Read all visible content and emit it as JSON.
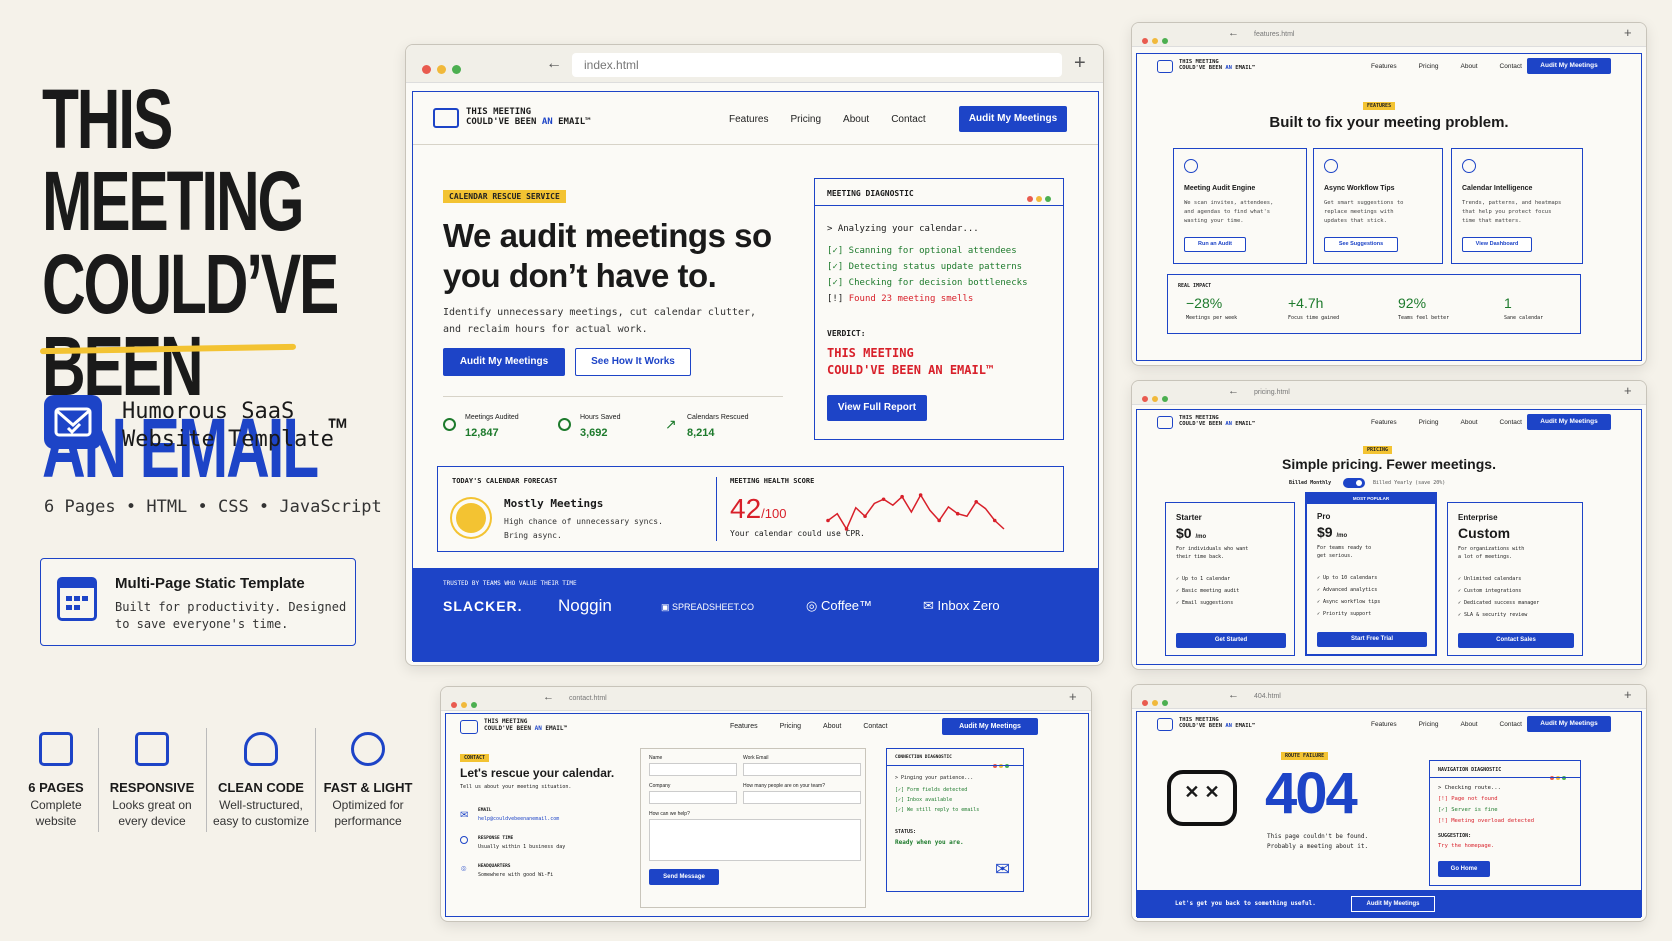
{
  "hero": {
    "line1": "THIS MEETING",
    "line2": "COULD’VE BEEN",
    "line3": "AN EMAIL",
    "tm": "™"
  },
  "subtitle": {
    "line1": "Humorous SaaS",
    "line2": "Website Template"
  },
  "tech": "6 Pages • HTML • CSS • JavaScript",
  "multipage": {
    "title": "Multi-Page Static Template",
    "desc1": "Built for productivity. Designed",
    "desc2": "to save everyone's time."
  },
  "features": [
    {
      "title": "6 PAGES",
      "d1": "Complete",
      "d2": "website",
      "icon": "pages-icon"
    },
    {
      "title": "RESPONSIVE",
      "d1": "Looks great on",
      "d2": "every device",
      "icon": "monitor-icon"
    },
    {
      "title": "CLEAN CODE",
      "d1": "Well-structured,",
      "d2": "easy to customize",
      "icon": "code-icon"
    },
    {
      "title": "FAST & LIGHT",
      "d1": "Optimized for",
      "d2": "performance",
      "icon": "speedometer-icon"
    }
  ],
  "nav": {
    "features": "Features",
    "pricing": "Pricing",
    "about": "About",
    "contact": "Contact",
    "cta": "Audit My Meetings"
  },
  "logo": {
    "l1": "THIS MEETING",
    "l2a": "COULD'VE BEEN ",
    "l2b": "AN",
    "l2c": " EMAIL™"
  },
  "main": {
    "url": "index.html",
    "tag": "CALENDAR RESCUE SERVICE",
    "h1a": "We audit meetings so",
    "h1b": "you don’t have to.",
    "p1": "Identify unnecessary meetings, cut calendar clutter,",
    "p2": "and reclaim hours for actual work.",
    "btn1": "Audit My Meetings",
    "btn2": "See How It Works",
    "stats": [
      {
        "label": "Meetings Audited",
        "value": "12,847"
      },
      {
        "label": "Hours Saved",
        "value": "3,692"
      },
      {
        "label": "Calendars Rescued",
        "value": "8,214"
      }
    ],
    "diag": {
      "title": "MEETING DIAGNOSTIC",
      "l0": "> Analyzing your calendar...",
      "l1": "[✓] Scanning for optional attendees",
      "l2": "[✓] Detecting status update patterns",
      "l3": "[✓] Checking for decision bottlenecks",
      "l4a": "[!] ",
      "l4b": "Found 23 meeting smells",
      "verdict": "VERDICT:",
      "v1": "THIS MEETING",
      "v2": "COULD'VE BEEN AN EMAIL™",
      "btn": "View Full Report"
    },
    "forecast": {
      "title": "TODAY'S CALENDAR FORECAST",
      "head": "Mostly Meetings",
      "d1": "High chance of unnecessary syncs.",
      "d2": "Bring async."
    },
    "health": {
      "title": "MEETING HEALTH SCORE",
      "score": "42",
      "out": "/100",
      "note": "Your calendar could use CPR.",
      "spark": [
        30,
        38,
        20,
        45,
        35,
        50,
        55,
        48,
        58,
        40,
        60,
        42,
        30,
        46,
        38,
        35,
        52,
        44,
        30,
        20
      ]
    },
    "trusted": "TRUSTED BY TEAMS WHO VALUE THEIR TIME",
    "brands": [
      "SLACKER.",
      "Noggin",
      "SPREADSHEET.CO",
      "Coffee™",
      "Inbox Zero"
    ]
  },
  "featpage": {
    "url": "features.html",
    "tag": "FEATURES",
    "title": "Built to fix your meeting problem.",
    "cards": [
      {
        "t": "Meeting Audit Engine",
        "d1": "We scan invites, attendees,",
        "d2": "and agendas to find what's",
        "d3": "wasting your time.",
        "b": "Run an Audit"
      },
      {
        "t": "Async Workflow Tips",
        "d1": "Get smart suggestions to",
        "d2": "replace meetings with",
        "d3": "updates that stick.",
        "b": "See Suggestions"
      },
      {
        "t": "Calendar Intelligence",
        "d1": "Trends, patterns, and heatmaps",
        "d2": "that help you protect focus",
        "d3": "time that matters.",
        "b": "View Dashboard"
      }
    ],
    "impact": "REAL IMPACT",
    "stats": [
      {
        "v": "−28%",
        "l": "Meetings per week"
      },
      {
        "v": "+4.7h",
        "l": "Focus time gained"
      },
      {
        "v": "92%",
        "l": "Teams feel better"
      },
      {
        "v": "1",
        "l": "Sane calendar"
      }
    ]
  },
  "pricepage": {
    "url": "pricing.html",
    "tag": "PRICING",
    "title": "Simple pricing. Fewer meetings.",
    "monthly": "Billed Monthly",
    "yearly": "Billed Yearly (save 20%)",
    "popular": "MOST POPULAR",
    "plans": [
      {
        "n": "Starter",
        "p": "$0",
        "u": "/mo",
        "d1": "For individuals who want",
        "d2": "their time back.",
        "f": [
          "Up to 1 calendar",
          "Basic meeting audit",
          "Email suggestions"
        ],
        "b": "Get Started"
      },
      {
        "n": "Pro",
        "p": "$9",
        "u": "/mo",
        "d1": "For teams ready to",
        "d2": "get serious.",
        "f": [
          "Up to 10 calendars",
          "Advanced analytics",
          "Async workflow tips",
          "Priority support"
        ],
        "b": "Start Free Trial"
      },
      {
        "n": "Enterprise",
        "p": "Custom",
        "u": "",
        "d1": "For organizations with",
        "d2": "a lot of meetings.",
        "f": [
          "Unlimited calendars",
          "Custom integrations",
          "Dedicated success manager",
          "SLA & security review"
        ],
        "b": "Contact Sales"
      }
    ]
  },
  "contactpage": {
    "url": "contact.html",
    "tag": "CONTACT",
    "title": "Let's rescue your calendar.",
    "sub": "Tell us about your meeting situation.",
    "info": [
      {
        "l": "EMAIL",
        "v": "help@couldvebeenanemail.com"
      },
      {
        "l": "RESPONSE TIME",
        "v": "Usually within 1 business day"
      },
      {
        "l": "HEADQUARTERS",
        "v": "Somewhere with good Wi-Fi"
      }
    ],
    "f_name": "Name",
    "f_email": "Work Email",
    "f_company": "Company",
    "f_people": "How many people are on your team?",
    "f_help": "How can we help?",
    "send": "Send Message",
    "diag": {
      "title": "CONNECTION DIAGNOSTIC",
      "l0": "> Pinging your patience...",
      "l1": "[✓] Form fields detected",
      "l2": "[✓] Inbox available",
      "l3": "[✓] We still reply to emails",
      "status": "STATUS:",
      "ready": "Ready when you are."
    }
  },
  "errpage": {
    "url": "404.html",
    "tag": "ROUTE FAILURE",
    "code": "404",
    "m1": "This page couldn't be found.",
    "m2": "Probably a meeting about it.",
    "diag": {
      "title": "NAVIGATION DIAGNOSTIC",
      "l0": "> Checking route...",
      "l1": "[!] Page not found",
      "l2": "[✓] Server is fine",
      "l3": "[!] Meeting overload detected",
      "sug": "SUGGESTION:",
      "try": "Try the homepage.",
      "btn": "Go Home"
    },
    "footer": "Let's get you back to something useful.",
    "footbtn": "Audit My Meetings"
  },
  "colors": {
    "accent": "#1d44c7",
    "highlight": "#f3c332",
    "alert": "#d8202a",
    "ok": "#1d7a2c"
  }
}
